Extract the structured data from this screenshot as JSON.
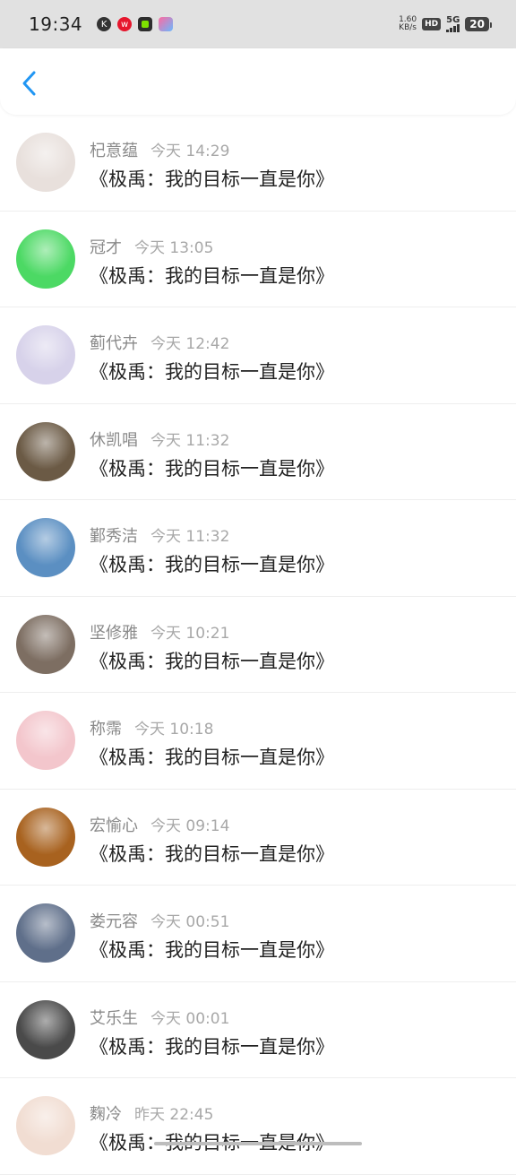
{
  "status_bar": {
    "time": "19:34",
    "speed_top": "1.60",
    "speed_bottom": "KB/s",
    "hd": "HD",
    "network": "5G",
    "battery": "20"
  },
  "header": {
    "back_icon": "chevron-left-icon"
  },
  "colors": {
    "accent": "#2196f3",
    "name": "#8a8a8a",
    "time": "#a8a8a8",
    "message": "#222222"
  },
  "comments": [
    {
      "name": "杞意蕴",
      "time": "今天 14:29",
      "message": "《极禹：我的目标一直是你》",
      "avatar_bg": "#e8e0dc"
    },
    {
      "name": "冠才",
      "time": "今天 13:05",
      "message": "《极禹：我的目标一直是你》",
      "avatar_bg": "#4cd964"
    },
    {
      "name": "蓟代卉",
      "time": "今天 12:42",
      "message": "《极禹：我的目标一直是你》",
      "avatar_bg": "#d7d2ea"
    },
    {
      "name": "休凯唱",
      "time": "今天 11:32",
      "message": "《极禹：我的目标一直是你》",
      "avatar_bg": "#6b5a45"
    },
    {
      "name": "鄞秀洁",
      "time": "今天 11:32",
      "message": "《极禹：我的目标一直是你》",
      "avatar_bg": "#5b8fc2"
    },
    {
      "name": "坚修雅",
      "time": "今天 10:21",
      "message": "《极禹：我的目标一直是你》",
      "avatar_bg": "#7d6e62"
    },
    {
      "name": "称霈",
      "time": "今天 10:18",
      "message": "《极禹：我的目标一直是你》",
      "avatar_bg": "#f3c6cc"
    },
    {
      "name": "宏愉心",
      "time": "今天 09:14",
      "message": "《极禹：我的目标一直是你》",
      "avatar_bg": "#a8621f"
    },
    {
      "name": "娄元容",
      "time": "今天 00:51",
      "message": "《极禹：我的目标一直是你》",
      "avatar_bg": "#5f6f8a"
    },
    {
      "name": "艾乐生",
      "time": "今天 00:01",
      "message": "《极禹：我的目标一直是你》",
      "avatar_bg": "#4a4a4a"
    },
    {
      "name": "麴冷",
      "time": "昨天 22:45",
      "message": "《极禹：我的目标一直是你》",
      "avatar_bg": "#f1ddd2"
    }
  ]
}
